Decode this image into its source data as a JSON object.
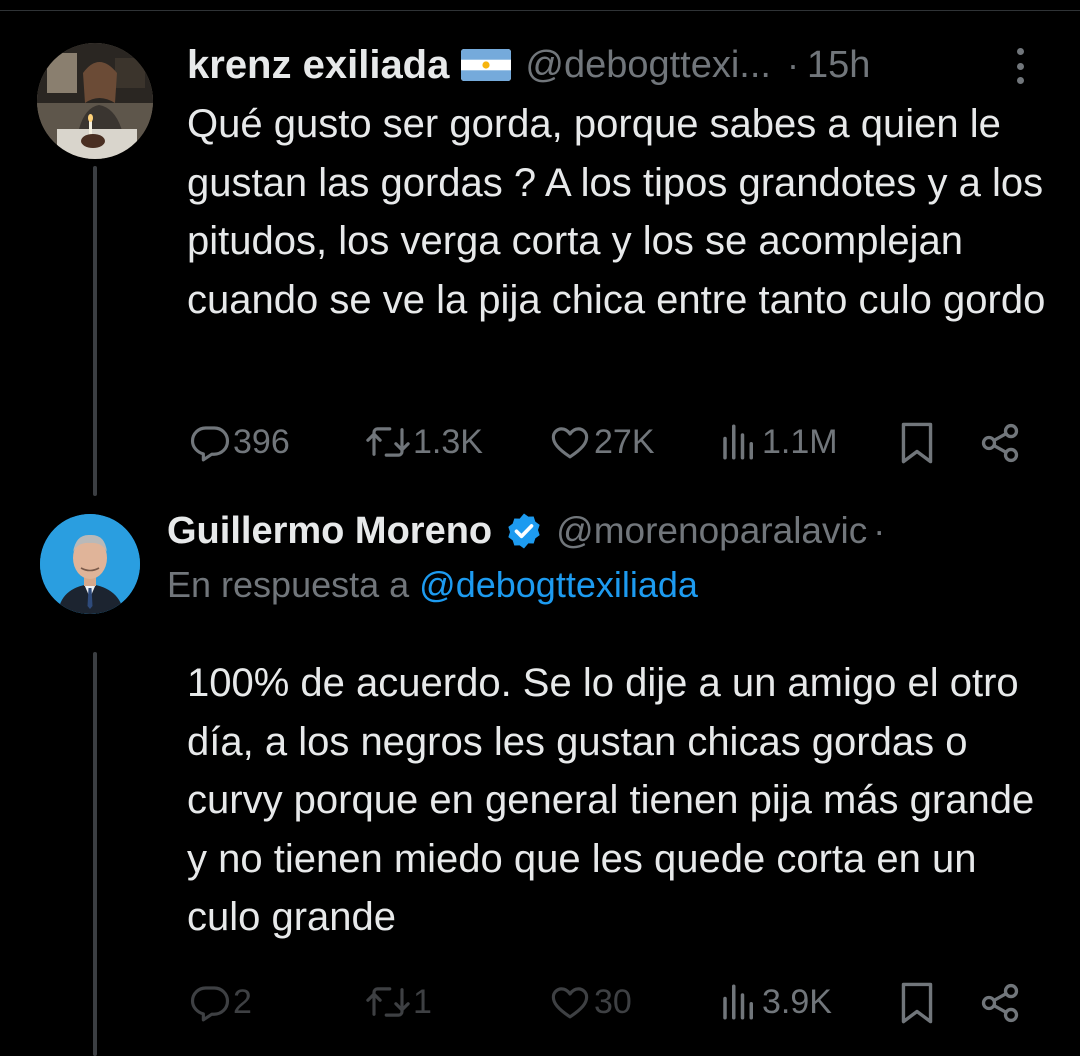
{
  "tweet1": {
    "display_name": "krenz exiliada",
    "flag_icon": "argentina-flag-icon",
    "handle": "@debogttexi...",
    "separator": "·",
    "time": "15h",
    "text": "Qué gusto ser gorda, porque sabes a quien le gustan las gordas ? A los tipos grandotes y a los pitudos, los verga corta y los se acomplejan cuando se ve la pija chica entre tanto culo gordo",
    "replies": "396",
    "retweets": "1.3K",
    "likes": "27K",
    "views": "1.1M"
  },
  "tweet2": {
    "display_name": "Guillermo Moreno",
    "verified_icon": "verified-badge-icon",
    "handle": "@morenoparalavic",
    "separator": "·",
    "reply_prefix": "En respuesta a",
    "reply_mention": "@debogttexiliada",
    "text": "100% de acuerdo. Se lo dije a un amigo el otro día, a los negros les gustan chicas gordas o curvy porque en general tienen pija más grande y no tienen miedo que les quede corta en un culo grande",
    "replies": "2",
    "retweets": "1",
    "likes": "30",
    "views": "3.9K"
  },
  "colors": {
    "background": "#000000",
    "text": "#e7e9ea",
    "secondary": "#71767b",
    "accent": "#1d9bf0",
    "thread_line": "#3b3e42"
  }
}
